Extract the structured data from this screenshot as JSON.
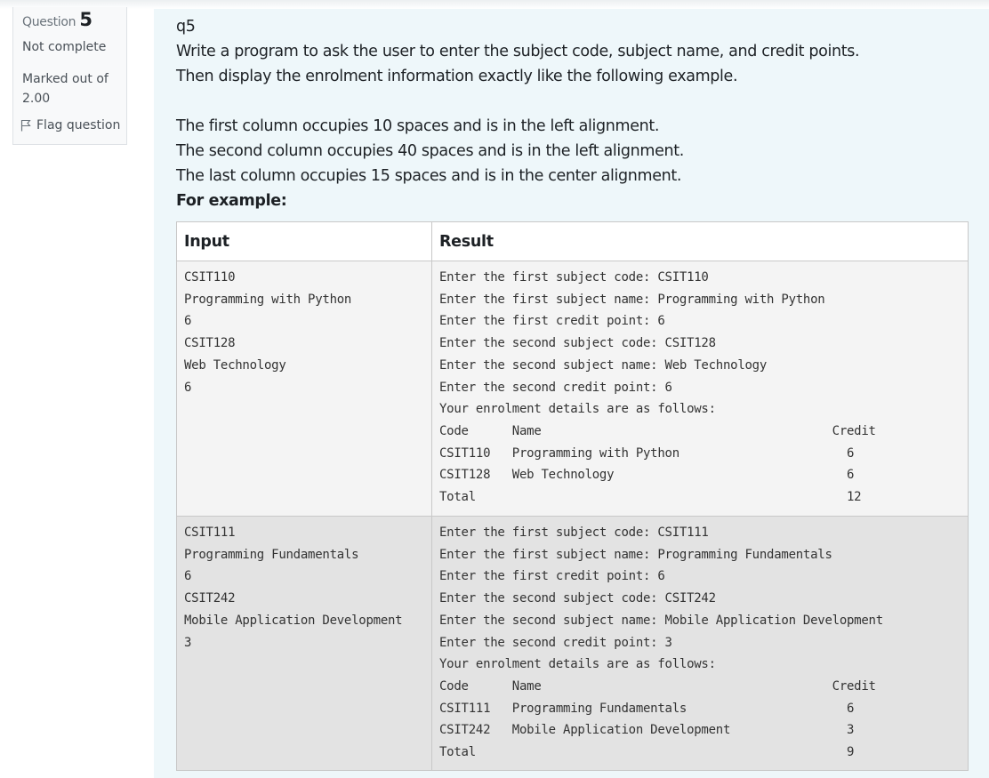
{
  "info": {
    "question_label": "Question",
    "question_number": "5",
    "state": "Not complete",
    "grade": "Marked out of 2.00",
    "flag_label": "Flag question"
  },
  "question": {
    "title": "q5",
    "line1": "Write a program to ask the user to enter the subject code, subject name, and credit points.",
    "line2": "Then display the enrolment information exactly like the following example.",
    "line3": "The first column occupies 10 spaces and is in the left alignment.",
    "line4": "The second column occupies 40 spaces and is in the left alignment.",
    "line5": "The last column occupies 15 spaces and is in the center alignment.",
    "example_label": "For example:"
  },
  "table": {
    "headers": {
      "input": "Input",
      "result": "Result"
    },
    "rows": [
      {
        "input": "CSIT110\nProgramming with Python\n6\nCSIT128\nWeb Technology\n6",
        "result": "Enter the first subject code: CSIT110\nEnter the first subject name: Programming with Python\nEnter the first credit point: 6\nEnter the second subject code: CSIT128\nEnter the second subject name: Web Technology\nEnter the second credit point: 6\nYour enrolment details are as follows:\nCode      Name                                        Credit\nCSIT110   Programming with Python                       6\nCSIT128   Web Technology                                6\nTotal                                                   12"
      },
      {
        "input": "CSIT111\nProgramming Fundamentals\n6\nCSIT242\nMobile Application Development\n3",
        "result": "Enter the first subject code: CSIT111\nEnter the first subject name: Programming Fundamentals\nEnter the first credit point: 6\nEnter the second subject code: CSIT242\nEnter the second subject name: Mobile Application Development\nEnter the second credit point: 3\nYour enrolment details are as follows:\nCode      Name                                        Credit\nCSIT111   Programming Fundamentals                      6\nCSIT242   Mobile Application Development                3\nTotal                                                   9"
      }
    ]
  },
  "colors": {
    "content_bg": "#eef7fa",
    "info_bg": "#f8f9fa",
    "row1_bg": "#f4f4f4",
    "row2_bg": "#e3e3e3"
  },
  "icons": {
    "flag": "flag-icon"
  }
}
